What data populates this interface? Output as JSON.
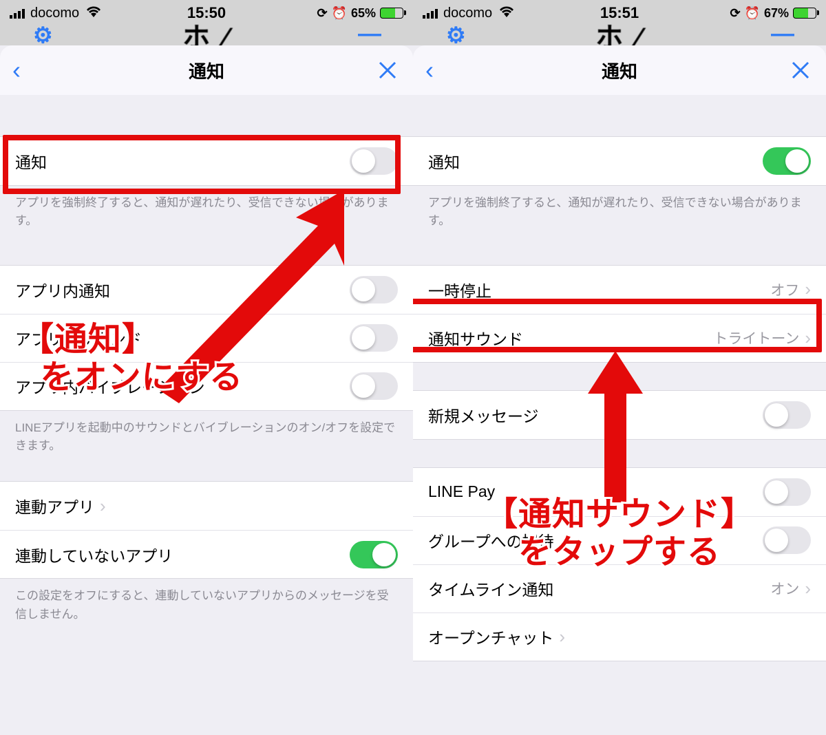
{
  "left": {
    "status": {
      "carrier": "docomo",
      "time": "15:50",
      "battery": "65%"
    },
    "title": "通知",
    "cells": {
      "notif": "通知",
      "note": "アプリを強制終了すると、通知が遅れたり、受信できない場合があります。",
      "inapp_notif": "アプリ内通知",
      "inapp_sound": "アプリ内サウンド",
      "inapp_vib": "アプリ内バイブレーション",
      "inapp_note": "LINEアプリを起動中のサウンドとバイブレーションのオン/オフを設定できます。",
      "linked": "連動アプリ",
      "unlinked": "連動していないアプリ",
      "unlinked_note": "この設定をオフにすると、連動していないアプリからのメッセージを受信しません。"
    },
    "callout_l1": "【通知】",
    "callout_l2": "をオンにする"
  },
  "right": {
    "status": {
      "carrier": "docomo",
      "time": "15:51",
      "battery": "67%"
    },
    "title": "通知",
    "cells": {
      "notif": "通知",
      "note": "アプリを強制終了すると、通知が遅れたり、受信できない場合があります。",
      "pause": "一時停止",
      "pause_val": "オフ",
      "sound": "通知サウンド",
      "sound_val": "トライトーン",
      "new_msg": "新規メッセージ",
      "line_pay": "LINE Pay",
      "group": "グループへの招待",
      "timeline": "タイムライン通知",
      "timeline_val": "オン",
      "openchat": "オープンチャット"
    },
    "callout_l1": "【通知サウンド】",
    "callout_l2": "をタップする"
  },
  "blur_center": "ホーム"
}
